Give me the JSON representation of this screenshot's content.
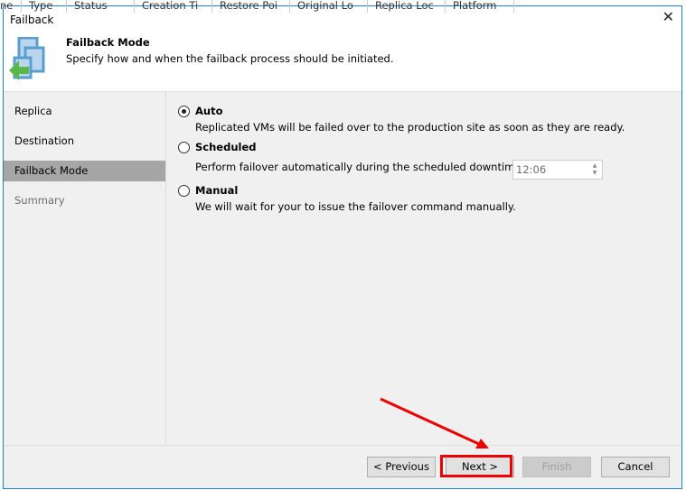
{
  "background_columns": [
    "ne",
    "Type",
    "Status",
    "Creation Ti",
    "Restore Poi",
    "Original Lo",
    "Replica Loc",
    "Platform"
  ],
  "window": {
    "title": "Failback",
    "close_icon": "close-icon"
  },
  "header": {
    "title": "Failback Mode",
    "subtitle": "Specify how and when the failback process should be initiated.",
    "icon": "failback-icon"
  },
  "nav": {
    "items": [
      {
        "label": "Replica"
      },
      {
        "label": "Destination"
      },
      {
        "label": "Failback Mode",
        "selected": true
      },
      {
        "label": "Summary",
        "disabled": true
      }
    ]
  },
  "options": [
    {
      "label": "Auto",
      "selected": true,
      "description": "Replicated VMs will be failed over to the production site as soon as they are ready."
    },
    {
      "label": "Scheduled",
      "selected": false,
      "description": "Perform failover automatically during the scheduled downtime at:",
      "time": "12:06"
    },
    {
      "label": "Manual",
      "selected": false,
      "description": "We will wait for your to issue the failover command manually."
    }
  ],
  "buttons": {
    "previous": "< Previous",
    "next": "Next >",
    "finish": "Finish",
    "cancel": "Cancel"
  },
  "colors": {
    "accent": "#1883d7",
    "annotation": "#e00000"
  }
}
